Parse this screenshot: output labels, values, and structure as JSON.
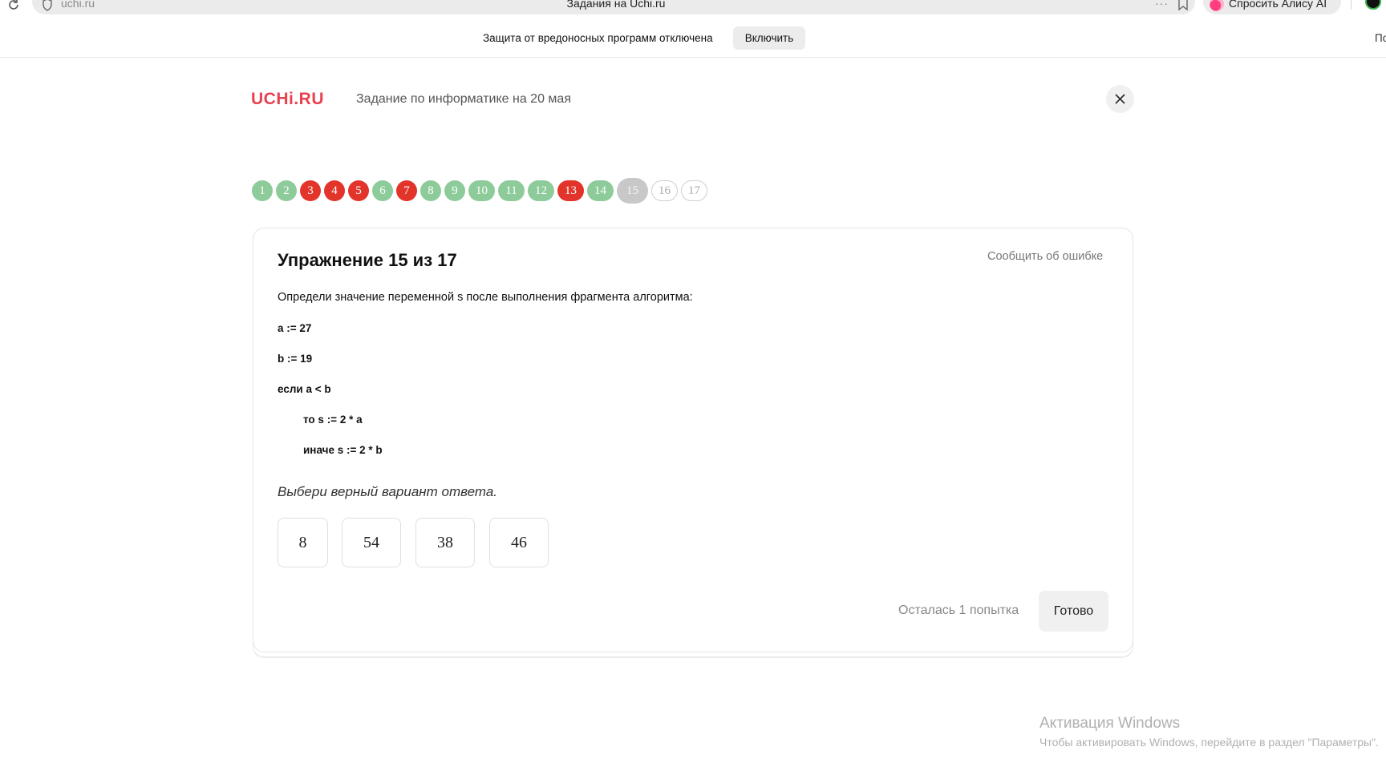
{
  "browser": {
    "url": "uchi.ru",
    "tab_title": "Задания на Uchi.ru",
    "menu_dots": "···",
    "alice_label": "Спросить Алису AI"
  },
  "notice": {
    "text": "Защита от вредоносных программ отключена",
    "button_label": "Включить",
    "cut_text": "По"
  },
  "header": {
    "logo": "UCHi.RU",
    "subtitle": "Задание по информатике на 20 мая"
  },
  "progress": {
    "items": [
      {
        "label": "1",
        "status": "correct"
      },
      {
        "label": "2",
        "status": "correct"
      },
      {
        "label": "3",
        "status": "wrong"
      },
      {
        "label": "4",
        "status": "wrong"
      },
      {
        "label": "5",
        "status": "wrong"
      },
      {
        "label": "6",
        "status": "correct"
      },
      {
        "label": "7",
        "status": "wrong"
      },
      {
        "label": "8",
        "status": "correct"
      },
      {
        "label": "9",
        "status": "correct"
      },
      {
        "label": "10",
        "status": "correct"
      },
      {
        "label": "11",
        "status": "correct"
      },
      {
        "label": "12",
        "status": "correct"
      },
      {
        "label": "13",
        "status": "wrong"
      },
      {
        "label": "14",
        "status": "correct"
      },
      {
        "label": "15",
        "status": "current"
      },
      {
        "label": "16",
        "status": "pending"
      },
      {
        "label": "17",
        "status": "pending"
      }
    ]
  },
  "card": {
    "title": "Упражнение 15 из 17",
    "report_label": "Сообщить об ошибке",
    "question": "Определи значение переменной s после выполнения фрагмента алгоритма:",
    "code": [
      "a := 27",
      "b := 19",
      "если a < b",
      "то s := 2 * a",
      "иначе s := 2 * b"
    ],
    "choose_prompt": "Выбери верный вариант ответа.",
    "answers": [
      "8",
      "54",
      "38",
      "46"
    ],
    "attempts_text": "Осталась 1 попытка",
    "done_label": "Готово"
  },
  "watermark": {
    "title": "Активация Windows",
    "subtitle": "Чтобы активировать Windows, перейдите в раздел \"Параметры\"."
  },
  "colors": {
    "correct": "#8dcb9a",
    "wrong": "#e2342b",
    "current": "#c8c8c8",
    "logo": "#e8414f"
  }
}
